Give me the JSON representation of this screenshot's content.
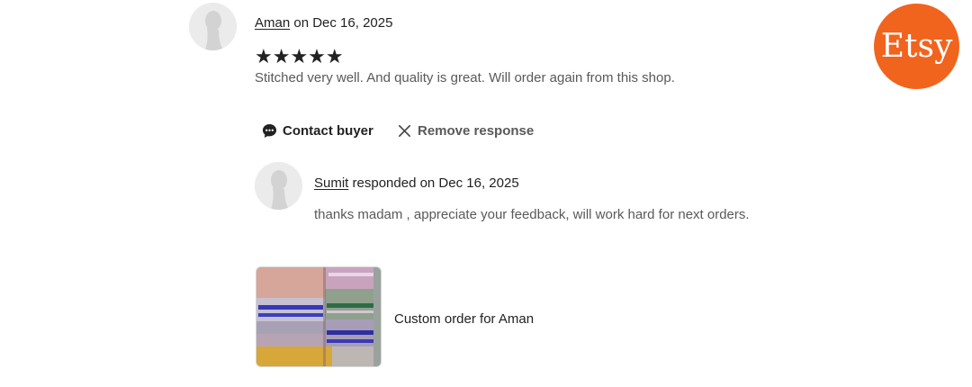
{
  "review": {
    "reviewer_name": "Aman",
    "date_text": "on Dec 16, 2025",
    "rating": 5,
    "stars_text": "★★★★★",
    "text": "Stitched very well. And quality is great. Will order again from this shop."
  },
  "actions": {
    "contact_label": "Contact buyer",
    "remove_label": "Remove response"
  },
  "response": {
    "seller_name": "Sumit",
    "date_text": "responded on Dec 16, 2025",
    "text": "thanks madam , appreciate your feedback, will work hard for next orders."
  },
  "order": {
    "label": "Custom order for Aman"
  },
  "brand": {
    "logo_text": "Etsy",
    "color": "#f1641e"
  },
  "icons": {
    "contact": "chat-bubble-icon",
    "remove": "close-icon"
  }
}
